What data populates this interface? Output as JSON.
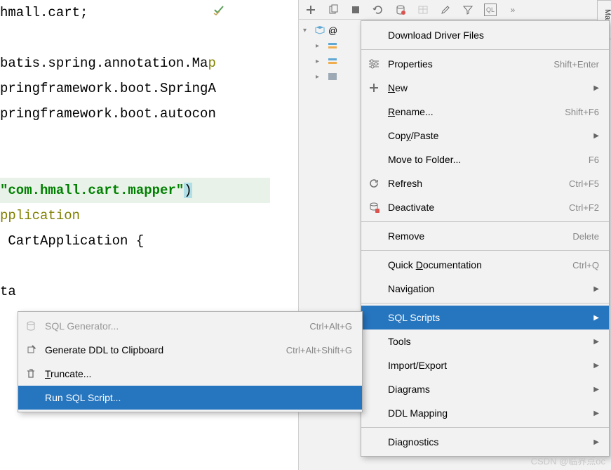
{
  "code": {
    "line1": "hmall.cart;",
    "line2": "batis.spring.annotation.Ma",
    "line3": "pringframework.boot.SpringA",
    "line4": "pringframework.boot.autocon",
    "line5_string": "\"com.hmall.cart.mapper\"",
    "line5_paren": ")",
    "line6": "pplication",
    "line7": " CartApplication {",
    "line8": "ta"
  },
  "sidebar_tab": "Maven",
  "tree": {
    "root_label": "@",
    "children": [
      "",
      "",
      ""
    ]
  },
  "main_menu": {
    "items": [
      {
        "label": "Download Driver Files",
        "icon": "",
        "shortcut": "",
        "arrow": false
      },
      {
        "sep": true
      },
      {
        "label": "Properties",
        "icon": "sliders",
        "shortcut": "Shift+Enter",
        "arrow": false
      },
      {
        "label": "New",
        "icon": "plus",
        "shortcut": "",
        "arrow": true,
        "mnemonic": "N"
      },
      {
        "label": "Rename...",
        "icon": "",
        "shortcut": "Shift+F6",
        "arrow": false,
        "mnemonic": "R"
      },
      {
        "label": "Copy/Paste",
        "icon": "",
        "shortcut": "",
        "arrow": true,
        "mnemonic": "y"
      },
      {
        "label": "Move to Folder...",
        "icon": "",
        "shortcut": "F6",
        "arrow": false
      },
      {
        "label": "Refresh",
        "icon": "refresh",
        "shortcut": "Ctrl+F5",
        "arrow": false
      },
      {
        "label": "Deactivate",
        "icon": "deactivate",
        "shortcut": "Ctrl+F2",
        "arrow": false
      },
      {
        "sep": true
      },
      {
        "label": "Remove",
        "icon": "",
        "shortcut": "Delete",
        "arrow": false
      },
      {
        "sep": true
      },
      {
        "label": "Quick Documentation",
        "icon": "",
        "shortcut": "Ctrl+Q",
        "arrow": false,
        "mnemonic": "D"
      },
      {
        "label": "Navigation",
        "icon": "",
        "shortcut": "",
        "arrow": true
      },
      {
        "sep": true
      },
      {
        "label": "SQL Scripts",
        "icon": "",
        "shortcut": "",
        "arrow": true,
        "selected": true
      },
      {
        "label": "Tools",
        "icon": "",
        "shortcut": "",
        "arrow": true
      },
      {
        "label": "Import/Export",
        "icon": "",
        "shortcut": "",
        "arrow": true
      },
      {
        "label": "Diagrams",
        "icon": "",
        "shortcut": "",
        "arrow": true
      },
      {
        "label": "DDL Mapping",
        "icon": "",
        "shortcut": "",
        "arrow": true
      },
      {
        "sep": true
      },
      {
        "label": "Diagnostics",
        "icon": "",
        "shortcut": "",
        "arrow": true
      }
    ]
  },
  "sub_menu": {
    "items": [
      {
        "label": "SQL Generator...",
        "icon": "db",
        "shortcut": "Ctrl+Alt+G",
        "disabled": true
      },
      {
        "label": "Generate DDL to Clipboard",
        "icon": "export",
        "shortcut": "Ctrl+Alt+Shift+G"
      },
      {
        "label": "Truncate...",
        "icon": "trash",
        "mnemonic": "T"
      },
      {
        "label": "Run SQL Script...",
        "icon": "",
        "selected": true
      }
    ]
  },
  "watermark": "CSDN @临界点oc"
}
